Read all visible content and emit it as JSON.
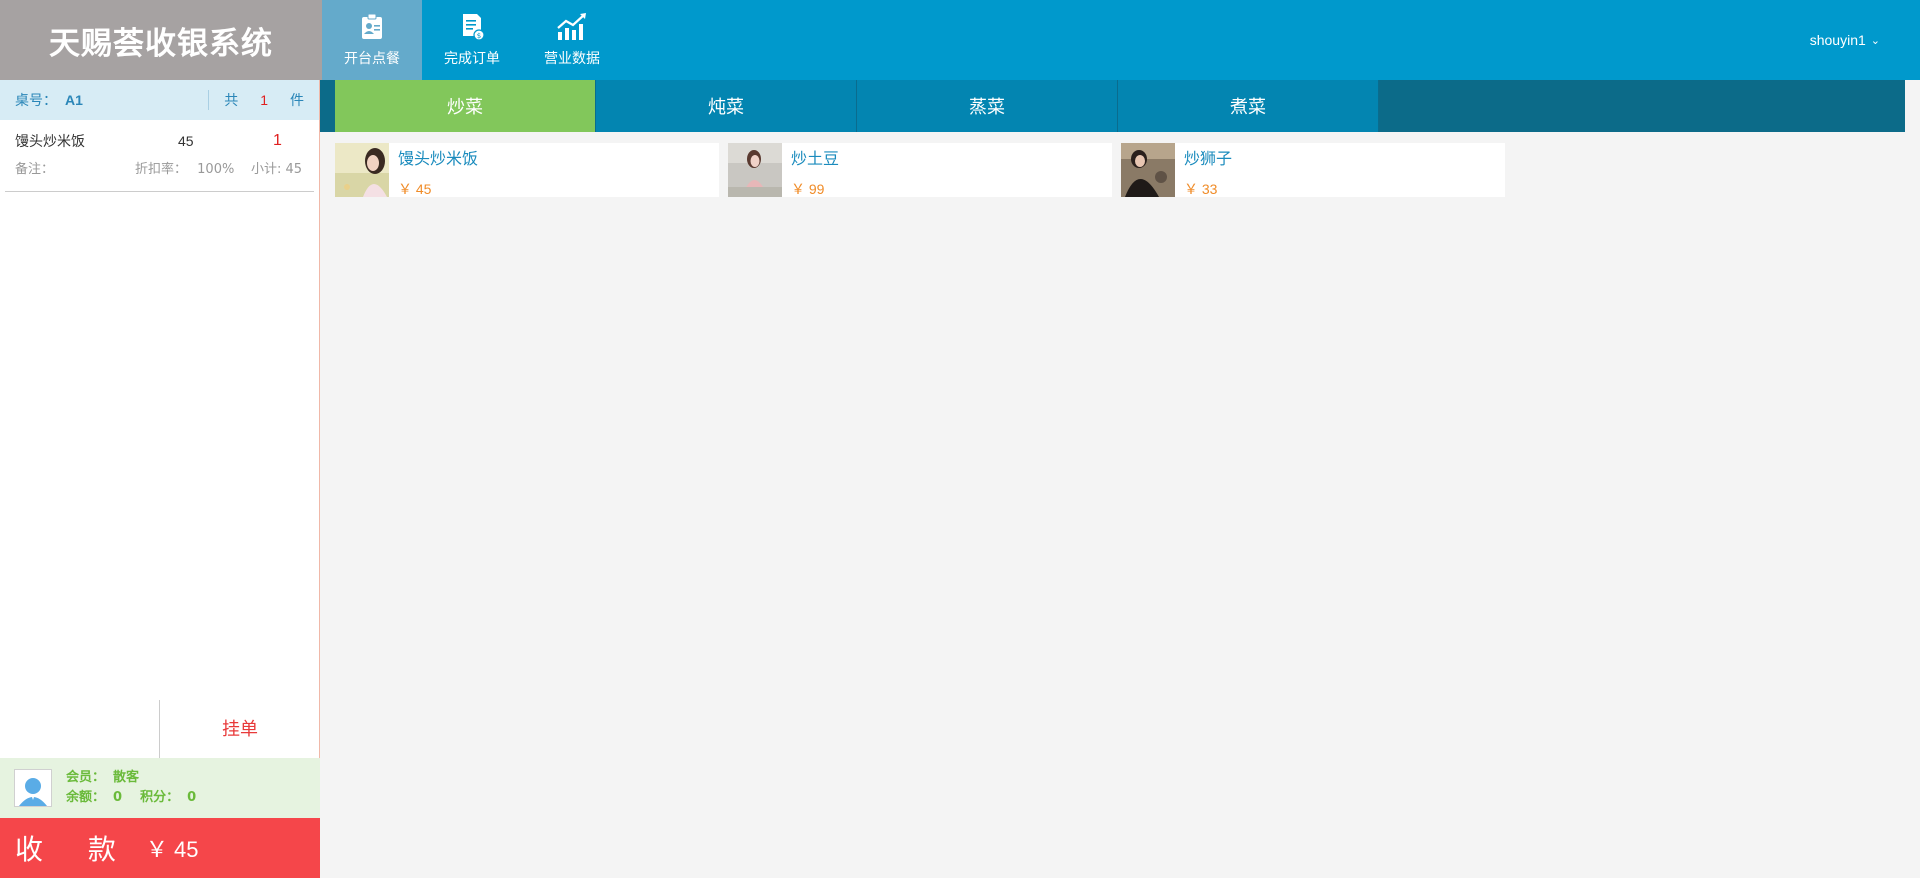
{
  "app": {
    "title": "天赐荟收银系统"
  },
  "nav": [
    {
      "label": "开台点餐",
      "icon": "id-card-icon"
    },
    {
      "label": "完成订单",
      "icon": "document-icon"
    },
    {
      "label": "营业数据",
      "icon": "chart-icon"
    }
  ],
  "user": {
    "name": "shouyin1",
    "caret": "⌄"
  },
  "order": {
    "table_label": "桌号：",
    "table_no": "A1",
    "total_prefix": "共",
    "total_count": "1",
    "total_suffix": "件",
    "items": [
      {
        "name": "馒头炒米饭",
        "price": "45",
        "qty": "1",
        "note_label": "备注：",
        "discount_label": "折扣率：",
        "discount": "100%",
        "subtotal": "小计: 45"
      }
    ],
    "hold_label": "挂单"
  },
  "member": {
    "member_label": "会员：",
    "member_value": "散客",
    "balance_label": "余额：",
    "balance_value": "0",
    "points_label": "积分：",
    "points_value": "0"
  },
  "checkout": {
    "label": "收 款",
    "amount": "￥ 45"
  },
  "tabs": [
    {
      "label": "炒菜"
    },
    {
      "label": "炖菜"
    },
    {
      "label": "蒸菜"
    },
    {
      "label": "煮菜"
    }
  ],
  "dishes": [
    {
      "name": "馒头炒米饭",
      "price": "￥ 45"
    },
    {
      "name": "炒土豆",
      "price": "￥ 99"
    },
    {
      "name": "炒狮子",
      "price": "￥ 33"
    }
  ],
  "colors": {
    "header": "#0099cc",
    "logo_bg": "#a6a2a2",
    "tab_active": "#82c75b",
    "checkout": "#f5464a",
    "price": "#f08c28"
  }
}
